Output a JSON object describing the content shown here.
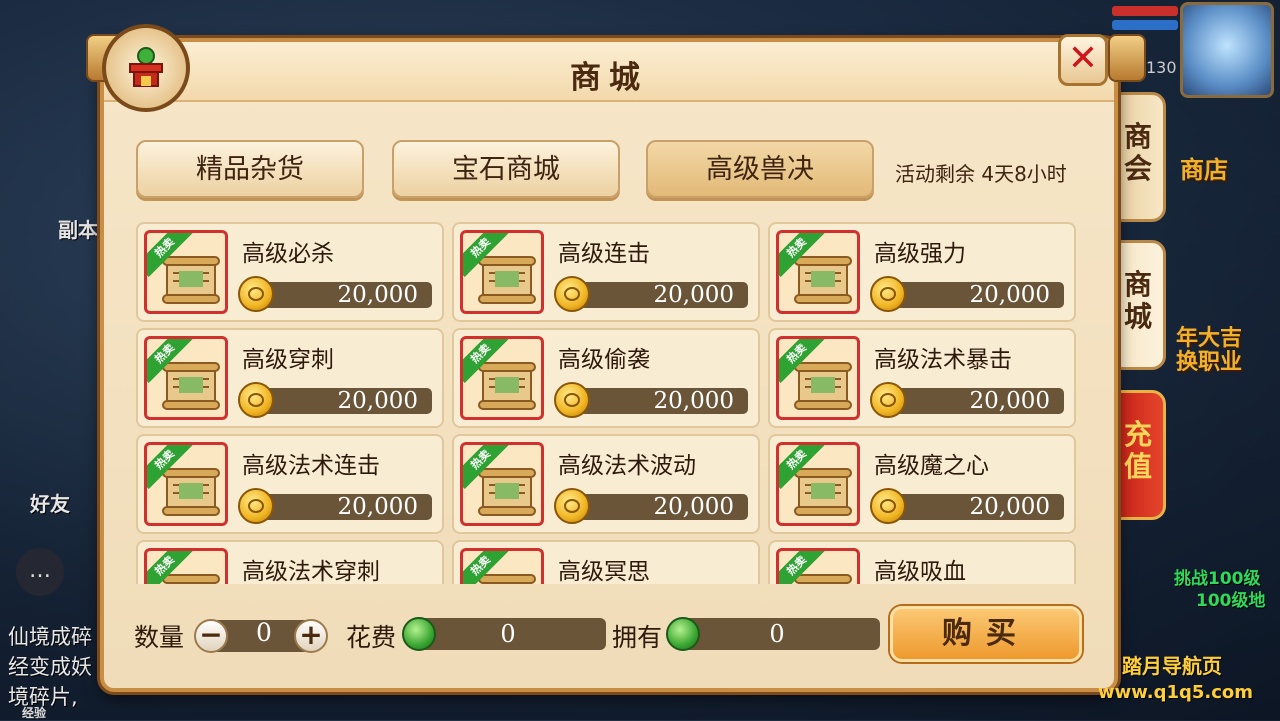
{
  "background": {
    "left_texts": [
      "副本",
      "好友",
      "仙境成碎",
      "经变成妖",
      "境碎片,"
    ],
    "right_texts": [
      "商店",
      "年大吉",
      "换职业",
      "挑战100级",
      "100级地"
    ],
    "level_badge": "130",
    "exp_label": "经验",
    "watermark_title": "踏月导航页",
    "watermark_url": "www.q1q5.com"
  },
  "panel": {
    "title": "商城",
    "close_icon": "close-icon"
  },
  "side_tabs": [
    {
      "label": "商会"
    },
    {
      "label": "商城"
    },
    {
      "label": "充值"
    }
  ],
  "categories": [
    {
      "label": "精品杂货"
    },
    {
      "label": "宝石商城"
    },
    {
      "label": "高级兽决"
    }
  ],
  "event_text": "活动剩余 4天8小时",
  "ribbon_label": "热卖",
  "items": [
    {
      "name": "高级必杀",
      "price": "20,000"
    },
    {
      "name": "高级连击",
      "price": "20,000"
    },
    {
      "name": "高级强力",
      "price": "20,000"
    },
    {
      "name": "高级穿刺",
      "price": "20,000"
    },
    {
      "name": "高级偷袭",
      "price": "20,000"
    },
    {
      "name": "高级法术暴击",
      "price": "20,000"
    },
    {
      "name": "高级法术连击",
      "price": "20,000"
    },
    {
      "name": "高级法术波动",
      "price": "20,000"
    },
    {
      "name": "高级魔之心",
      "price": "20,000"
    },
    {
      "name": "高级法术穿刺",
      "price": ""
    },
    {
      "name": "高级冥思",
      "price": ""
    },
    {
      "name": "高级吸血",
      "price": ""
    }
  ],
  "bottom": {
    "qty_label": "数量",
    "qty_value": "0",
    "minus": "−",
    "plus": "+",
    "cost_label": "花费",
    "cost_value": "0",
    "own_label": "拥有",
    "own_value": "0",
    "buy_label": "购买"
  },
  "colors": {
    "panel_bg": "#f6e6c8",
    "border": "#c98e45",
    "price_bar": "#6b5539",
    "ribbon": "#2ea232",
    "recharge": "#c51f16"
  }
}
